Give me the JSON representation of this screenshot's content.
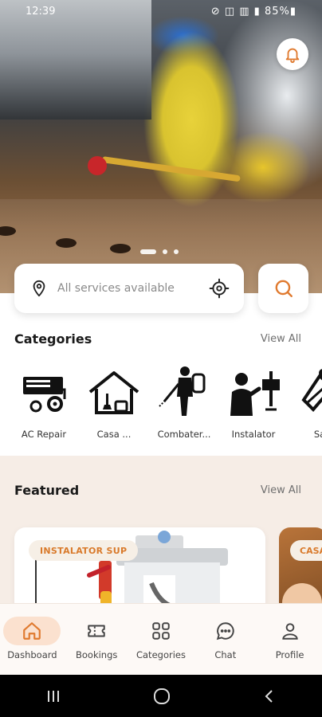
{
  "status_bar": {
    "time": "12:39",
    "icons_text": "⊘ ◫ ▥ ▮ 85%▮"
  },
  "hero": {
    "carousel_dots": 3,
    "active_dot": 0
  },
  "search": {
    "placeholder": "All services available"
  },
  "categories": {
    "title": "Categories",
    "view_all": "View All",
    "items": [
      {
        "label": "AC Repair",
        "icon": "ac-repair-icon"
      },
      {
        "label": "Casa ...",
        "icon": "house-icon"
      },
      {
        "label": "Combater...",
        "icon": "pest-control-icon"
      },
      {
        "label": "Instalator",
        "icon": "plumber-icon"
      },
      {
        "label": "Sa",
        "icon": "cleaning-icon"
      }
    ]
  },
  "featured": {
    "title": "Featured",
    "view_all": "View All",
    "cards": [
      {
        "tag": "INSTALATOR SUP"
      },
      {
        "tag": "CASA"
      }
    ]
  },
  "bottom_nav": [
    {
      "label": "Dashboard",
      "icon": "home-icon",
      "active": true
    },
    {
      "label": "Bookings",
      "icon": "ticket-icon",
      "active": false
    },
    {
      "label": "Categories",
      "icon": "grid-icon",
      "active": false
    },
    {
      "label": "Chat",
      "icon": "chat-icon",
      "active": false
    },
    {
      "label": "Profile",
      "icon": "user-icon",
      "active": false
    }
  ],
  "colors": {
    "accent": "#e07a2f",
    "nav_active_bg": "#fbe1cf",
    "featured_bg": "#f6ede6"
  }
}
